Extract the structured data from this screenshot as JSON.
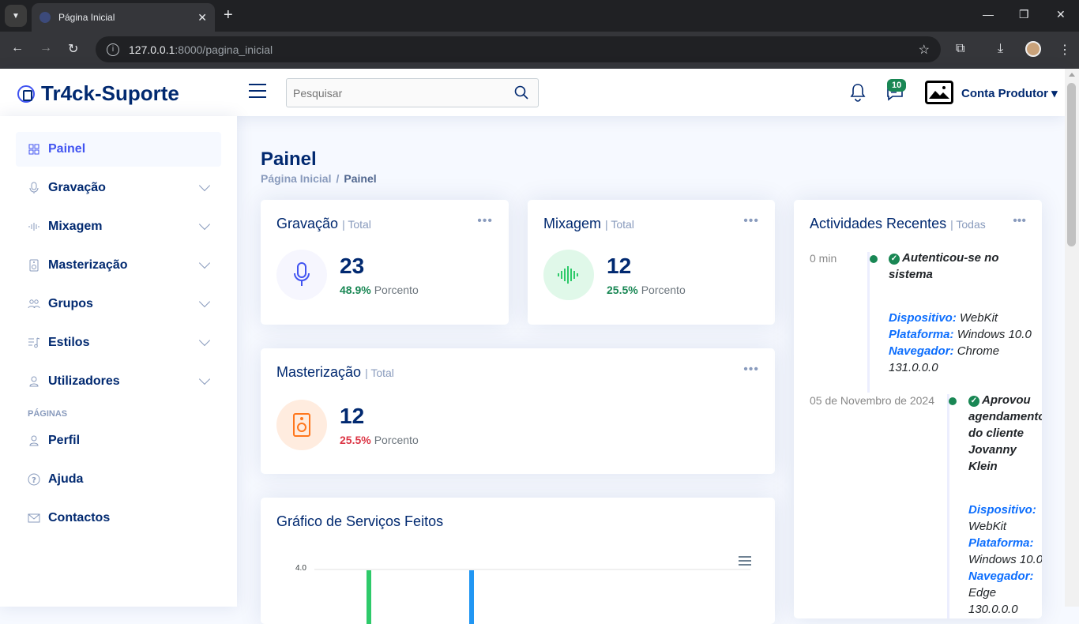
{
  "browser": {
    "tab_title": "Página Inicial",
    "url_host": "127.0.0.1",
    "url_path": ":8000/pagina_inicial"
  },
  "header": {
    "brand": "Tr4ck-Suporte",
    "search_placeholder": "Pesquisar",
    "messages_count": "10",
    "account_label": "Conta Produtor"
  },
  "sidebar": {
    "items": [
      {
        "label": "Painel",
        "icon": "grid-icon",
        "active": true
      },
      {
        "label": "Gravação",
        "icon": "microphone-icon"
      },
      {
        "label": "Mixagem",
        "icon": "soundwave-icon"
      },
      {
        "label": "Masterização",
        "icon": "speaker-icon"
      },
      {
        "label": "Grupos",
        "icon": "people-icon"
      },
      {
        "label": "Estilos",
        "icon": "music-list-icon"
      },
      {
        "label": "Utilizadores",
        "icon": "person-icon"
      }
    ],
    "heading": "Páginas",
    "pages": [
      {
        "label": "Perfil",
        "icon": "person-icon"
      },
      {
        "label": "Ajuda",
        "icon": "question-circle-icon"
      },
      {
        "label": "Contactos",
        "icon": "envelope-icon"
      }
    ]
  },
  "main": {
    "title": "Painel",
    "breadcrumb": [
      "Página Inicial",
      "Painel"
    ],
    "cards": {
      "gravacao": {
        "title": "Gravação",
        "sub": "| Total",
        "value": "23",
        "pct": "48.9%",
        "pct_label": "Porcento",
        "accent": "#4154f1"
      },
      "mixagem": {
        "title": "Mixagem",
        "sub": "| Total",
        "value": "12",
        "pct": "25.5%",
        "pct_label": "Porcento",
        "accent": "#2eca6a"
      },
      "masterizacao": {
        "title": "Masterização",
        "sub": "| Total",
        "value": "12",
        "pct": "25.5%",
        "pct_label": "Porcento",
        "accent": "#ff771d"
      }
    },
    "chart": {
      "title": "Gráfico de Serviços Feitos",
      "ytick_top": "4.0"
    },
    "activities": {
      "title": "Actividades Recentes",
      "sub": "| Todas",
      "items": [
        {
          "time": "0 min",
          "title": "Autenticou-se no sistema",
          "device_label": "Dispositivo:",
          "device": "WebKit",
          "platform_label": "Plataforma:",
          "platform": "Windows 10.0",
          "browser_label": "Navegador:",
          "browser": "Chrome 131.0.0.0"
        },
        {
          "time": "05 de Novembro de 2024",
          "title": "Aprovou agendamento do cliente Jovanny Klein",
          "device_label": "Dispositivo:",
          "device": "WebKit",
          "platform_label": "Plataforma:",
          "platform": "Windows 10.0",
          "browser_label": "Navegador:",
          "browser": "Edge 130.0.0.0"
        }
      ]
    }
  }
}
